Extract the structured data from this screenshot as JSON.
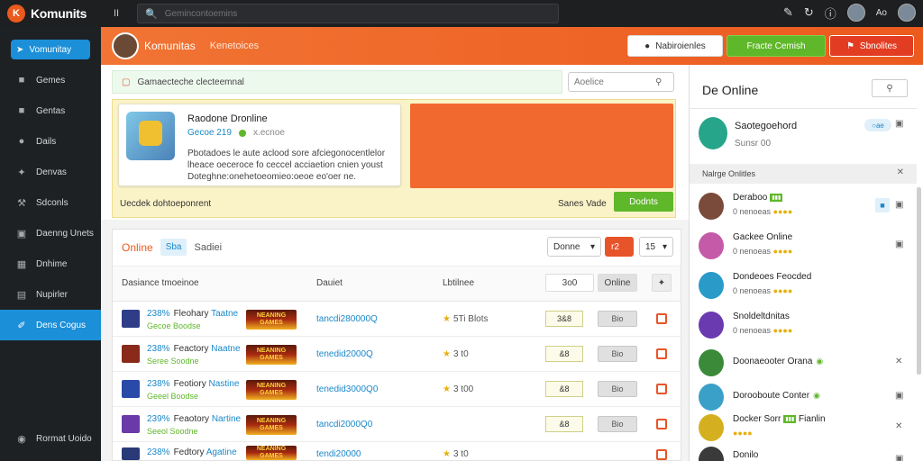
{
  "topbar": {
    "logo_mark": "K",
    "app_name": "Komunits",
    "mid_icon": "II",
    "search_placeholder": "Gemincontoemins",
    "right_text": "Ao"
  },
  "sidebar": {
    "header": "Vomunitay",
    "items": [
      {
        "label": "Gemes",
        "icon": "gamepad-icon"
      },
      {
        "label": "Gentas",
        "icon": "controller-icon"
      },
      {
        "label": "Dails",
        "icon": "chat-icon"
      },
      {
        "label": "Denvas",
        "icon": "puzzle-icon"
      },
      {
        "label": "Sdconls",
        "icon": "wrench-icon"
      },
      {
        "label": "Daenng Unets",
        "icon": "inbox-icon"
      },
      {
        "label": "Dnhime",
        "icon": "calendar-icon"
      },
      {
        "label": "Nupirler",
        "icon": "notebook-icon"
      },
      {
        "label": "Dens Cogus",
        "icon": "pencil-icon"
      }
    ],
    "bottom": "Rormat Uoido"
  },
  "header": {
    "title": "Komunitas",
    "subtitle": "Kenetoices",
    "btn_notifications": "Nabiroienles",
    "btn_green": "Fracte Cemish",
    "btn_red": "Sbnolites"
  },
  "main": {
    "announce": "Gamaecteche clecteemnal",
    "search_placeholder": "Aoelice",
    "featured": {
      "title": "Raodone Dronline",
      "meta_id": "Gecoe 219",
      "meta_extra": "x.ecnoe",
      "description": "Pbotadoes le aute aclood sore afciegonocentlelor lheace oeceroce fo ceccel acciaetion cnien youst Doteghne:onehetoeomieo:oeoe eo'oer ne.",
      "footer_left": "Uecdek dohtoeponrent",
      "footer_right": "Sanes Vade",
      "button": "Dodnts"
    },
    "tabs": {
      "active": "Online",
      "mid": "Sba",
      "plain": "Sadiei"
    },
    "filters": {
      "sort": "Donne",
      "red": "r2",
      "num": "15"
    },
    "columns": {
      "c1": "Dasiance tmoeinoe",
      "c2": "Dauiet",
      "c3": "Lbtilnee",
      "c4": "3o0",
      "c5": "Online"
    },
    "rows": [
      {
        "id": "238%",
        "name": "Fleohary",
        "kw": "Taatne",
        "sub": "Gecoe  Boodse",
        "badge": "NEANING GAMES",
        "link": "tancdi280000Q",
        "stat": "5Ti Blots",
        "score": "3&8",
        "btn": "Bio"
      },
      {
        "id": "238%",
        "name": "Feactory",
        "kw": "Naatne",
        "sub": "Seree  Soodne",
        "badge": "NEANING GAMES",
        "link": "tenedid2000Q",
        "stat": "3 t0",
        "score": "&8",
        "btn": "Bio"
      },
      {
        "id": "238%",
        "name": "Feotiory",
        "kw": "Nastine",
        "sub": "Geeel  Boodse",
        "badge": "NEANING GAMES",
        "link": "tenedid3000Q0",
        "stat": "3 t00",
        "score": "&8",
        "btn": "Bio"
      },
      {
        "id": "239%",
        "name": "Feaotory",
        "kw": "Nartine",
        "sub": "Seeol  Soodne",
        "badge": "NEANING GAMES",
        "link": "tancdi2000Q0",
        "stat": "",
        "score": "&8",
        "btn": "Bio"
      },
      {
        "id": "238%",
        "name": "Fedtory",
        "kw": "Agatine",
        "sub": "",
        "badge": "NEANING GAMES",
        "link": "tendi20000",
        "stat": "3 t0",
        "score": "",
        "btn": ""
      }
    ]
  },
  "right": {
    "title": "De Online",
    "me": {
      "name": "Saotegoehord",
      "status": "Sunsr 00",
      "badge": "○ae"
    },
    "section": "Nalrge Onlitles",
    "friends": [
      {
        "name": "Deraboo",
        "status": "0 nenoeas",
        "color": "#7a4a3a"
      },
      {
        "name": "Gackee Online",
        "status": "0 nenoeas",
        "color": "#c45aa8"
      },
      {
        "name": "Dondeoes Feocded",
        "status": "0 nenoeas",
        "color": "#2a9ac8"
      },
      {
        "name": "Snoldeltdnitas",
        "status": "0 nenoeas",
        "color": "#6a3ab0"
      },
      {
        "name": "Doonaeooter Orana",
        "status": "",
        "color": "#3a8a3a"
      },
      {
        "name": "Dorooboute Conter",
        "status": "",
        "color": "#3aa0c8"
      },
      {
        "name": "Docker Sorr",
        "status": "Fianlin",
        "color": "#d4b020"
      },
      {
        "name": "Donilo",
        "status": "",
        "color": "#3a3a3a"
      }
    ]
  },
  "colors": {
    "accent_orange": "#ec5a1e",
    "accent_blue": "#1b8fd8",
    "accent_green": "#5fb72a"
  }
}
